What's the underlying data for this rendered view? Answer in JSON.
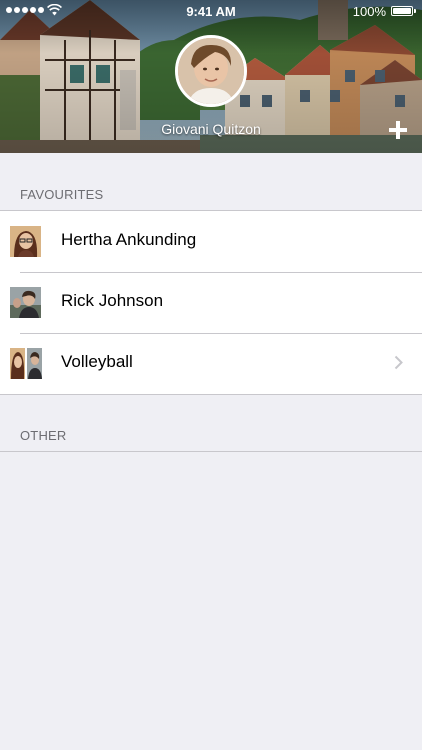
{
  "status_bar": {
    "time": "9:41 AM",
    "battery_percent": "100%",
    "battery_level": 1.0,
    "signal_bars": 5
  },
  "profile": {
    "name": "Giovani Quitzon",
    "add_icon": "plus-icon"
  },
  "sections": {
    "favourites": {
      "title": "FAVOURITES",
      "items": [
        {
          "label": "Hertha Ankunding",
          "thumbnail": "single-avatar"
        },
        {
          "label": "Rick Johnson",
          "thumbnail": "single-avatar"
        },
        {
          "label": "Volleyball",
          "thumbnail": "group-avatars",
          "accessory": "chevron-right-icon"
        }
      ]
    },
    "other": {
      "title": "OTHER",
      "items": []
    }
  },
  "colors": {
    "background": "#efeff4",
    "separator": "#c8c7cc",
    "section_text": "#6d6d72",
    "chevron": "#c7c7cc"
  }
}
